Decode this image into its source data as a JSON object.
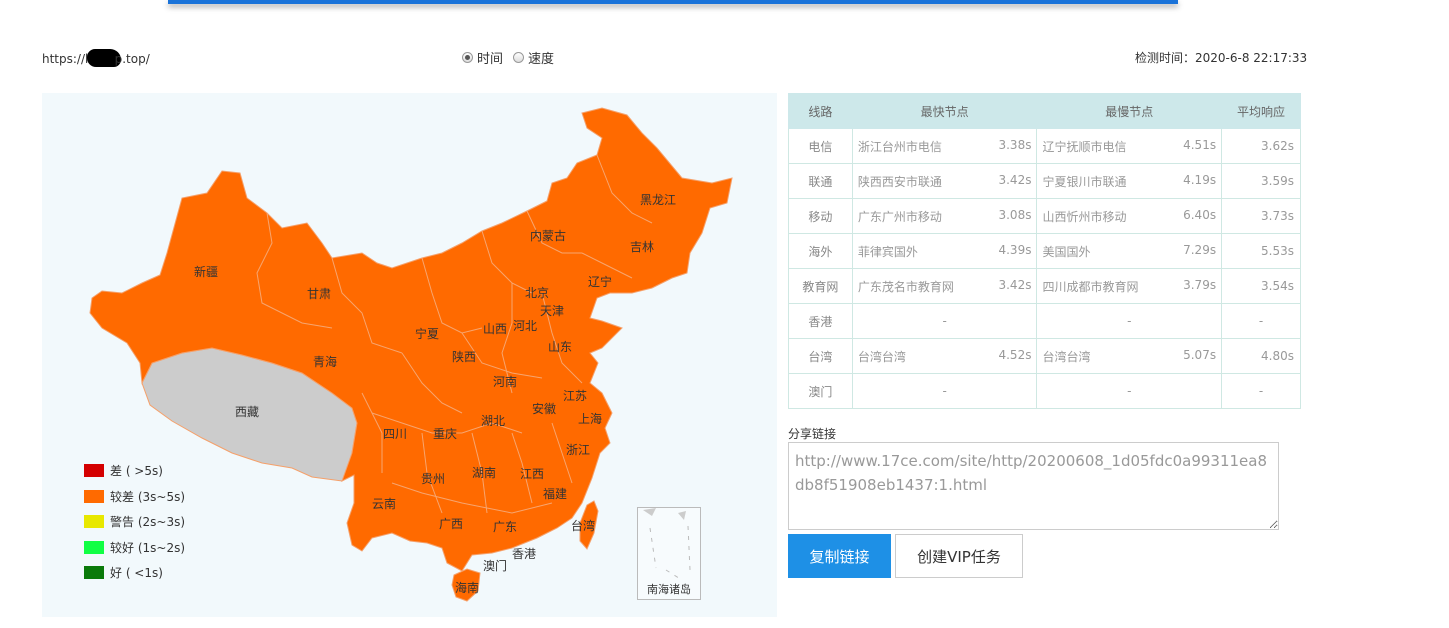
{
  "header": {
    "url_prefix": "https://h",
    "url_suffix": "p.top/",
    "radio_time": "时间",
    "radio_speed": "速度",
    "check_time": "检测时间：2020-6-8 22:17:33"
  },
  "map": {
    "provinces": {
      "heilongjiang": "黑龙江",
      "jilin": "吉林",
      "liaoning": "辽宁",
      "neimenggu": "内蒙古",
      "beijing": "北京",
      "tianjin": "天津",
      "hebei": "河北",
      "shanxi": "山西",
      "shandong": "山东",
      "ningxia": "宁夏",
      "gansu": "甘肃",
      "xinjiang": "新疆",
      "qinghai": "青海",
      "xizang": "西藏",
      "shaanxi": "陕西",
      "henan": "河南",
      "jiangsu": "江苏",
      "anhui": "安徽",
      "shanghai": "上海",
      "hubei": "湖北",
      "sichuan": "四川",
      "chongqing": "重庆",
      "zhejiang": "浙江",
      "guizhou": "贵州",
      "hunan": "湖南",
      "jiangxi": "江西",
      "fujian": "福建",
      "yunnan": "云南",
      "guangxi": "广西",
      "guangdong": "广东",
      "taiwan": "台湾",
      "xianggang": "香港",
      "aomen": "澳门",
      "hainan": "海南"
    },
    "south_sea_label": "南海诸岛",
    "colors": {
      "slow": "#ff6a00",
      "nodata": "#cccccc",
      "border": "#f5a06a"
    }
  },
  "legend": [
    {
      "label": "差 ( >5s)",
      "color": "#d40000"
    },
    {
      "label": "较差 (3s~5s)",
      "color": "#ff6a00"
    },
    {
      "label": "警告 (2s~3s)",
      "color": "#e8e800"
    },
    {
      "label": "较好 (1s~2s)",
      "color": "#11ff44"
    },
    {
      "label": "好 ( <1s)",
      "color": "#0a7a0a"
    }
  ],
  "table": {
    "headers": {
      "line": "线路",
      "fastest": "最快节点",
      "slowest": "最慢节点",
      "avg": "平均响应"
    },
    "rows": [
      {
        "line": "电信",
        "fast_node": "浙江台州市电信",
        "fast_time": "3.38s",
        "slow_node": "辽宁抚顺市电信",
        "slow_time": "4.51s",
        "avg": "3.62s"
      },
      {
        "line": "联通",
        "fast_node": "陕西西安市联通",
        "fast_time": "3.42s",
        "slow_node": "宁夏银川市联通",
        "slow_time": "4.19s",
        "avg": "3.59s"
      },
      {
        "line": "移动",
        "fast_node": "广东广州市移动",
        "fast_time": "3.08s",
        "slow_node": "山西忻州市移动",
        "slow_time": "6.40s",
        "avg": "3.73s"
      },
      {
        "line": "海外",
        "fast_node": "菲律宾国外",
        "fast_time": "4.39s",
        "slow_node": "美国国外",
        "slow_time": "7.29s",
        "avg": "5.53s"
      },
      {
        "line": "教育网",
        "fast_node": "广东茂名市教育网",
        "fast_time": "3.42s",
        "slow_node": "四川成都市教育网",
        "slow_time": "3.79s",
        "avg": "3.54s"
      },
      {
        "line": "香港",
        "empty": "-"
      },
      {
        "line": "台湾",
        "fast_node": "台湾台湾",
        "fast_time": "4.52s",
        "slow_node": "台湾台湾",
        "slow_time": "5.07s",
        "avg": "4.80s"
      },
      {
        "line": "澳门",
        "empty": "-"
      }
    ]
  },
  "share": {
    "label": "分享链接",
    "url": "http://www.17ce.com/site/http/20200608_1d05fdc0a99311ea8db8f51908eb1437:1.html",
    "copy_button": "复制链接",
    "vip_button": "创建VIP任务"
  }
}
